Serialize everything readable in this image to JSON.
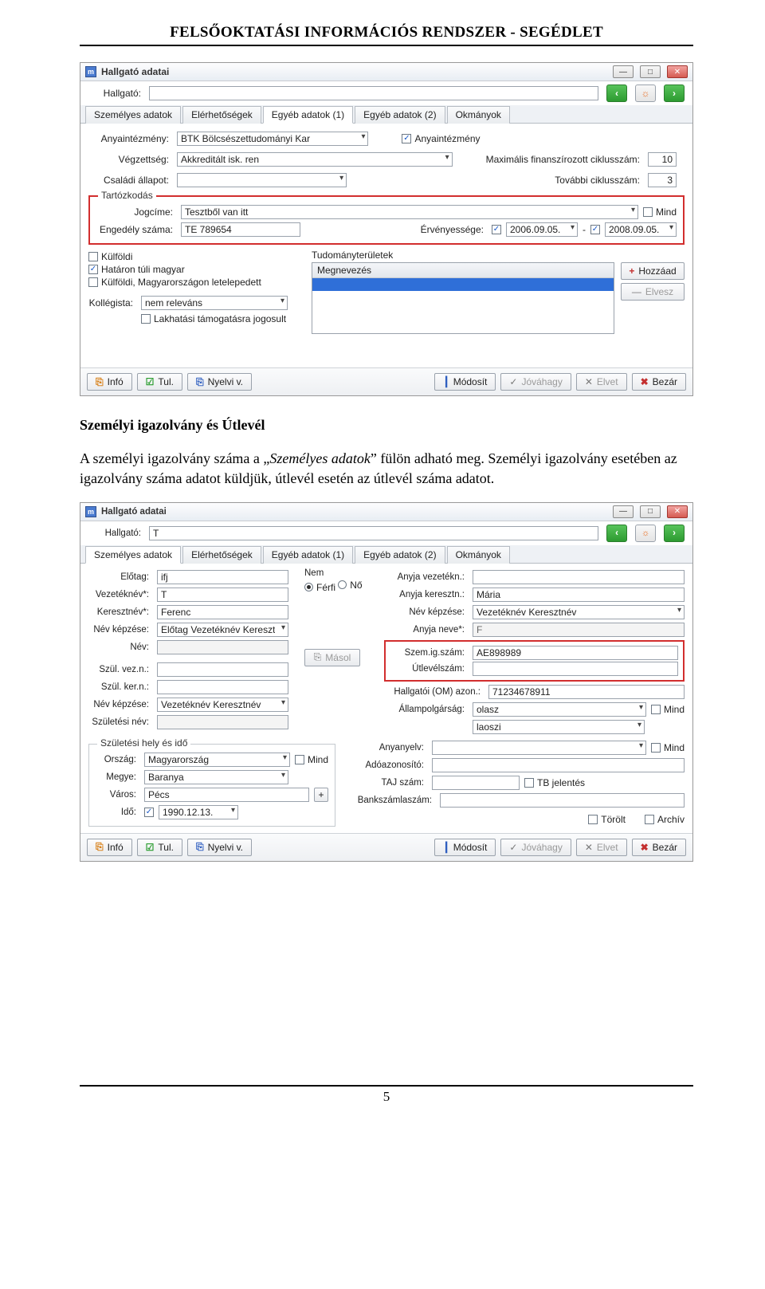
{
  "doc": {
    "header": "FELSŐOKTATÁSI INFORMÁCIÓS RENDSZER -  SEGÉDLET",
    "section_title": "Személyi igazolvány és Útlevél",
    "para1_a": "A személyi igazolvány száma a „",
    "para1_em": "Személyes adatok",
    "para1_b": "” fülön adható meg. Személyi igazolvány esetében az igazolvány száma adatot küldjük, útlevél esetén az útlevél száma adatot.",
    "page_num": "5"
  },
  "win1": {
    "title": "Hallgató adatai",
    "hallgato_label": "Hallgató:",
    "tabs": [
      "Személyes adatok",
      "Elérhetőségek",
      "Egyéb adatok (1)",
      "Egyéb adatok (2)",
      "Okmányok"
    ],
    "active_tab": 2,
    "anyaintezmeny_label": "Anyaintézmény:",
    "anyaintezmeny_value": "BTK Bölcsészettudományi Kar",
    "anyaintezmeny_chk": "Anyaintézmény",
    "vegzettseg_label": "Végzettség:",
    "vegzettseg_value": "Akkreditált isk. ren",
    "max_fin_label": "Maximális finanszírozott ciklusszám:",
    "max_fin_value": "10",
    "csaladi_label": "Családi állapot:",
    "tovabbi_label": "További ciklusszám:",
    "tovabbi_value": "3",
    "tartozkodas_title": "Tartózkodás",
    "jogcim_label": "Jogcíme:",
    "jogcim_value": "Tesztből van itt",
    "mind_label": "Mind",
    "engedely_label": "Engedély száma:",
    "engedely_value": "TE 789654",
    "ervenyesseg_label": "Érvényessége:",
    "date_from": "2006.09.05.",
    "date_to": "2008.09.05.",
    "kulfoldi": "Külföldi",
    "hataron": "Határon túli magyar",
    "kulfoldi_letelep": "Külföldi, Magyarországon letelepedett",
    "tudomany_title": "Tudományterületek",
    "megnevezes": "Megnevezés",
    "hozzaad": "Hozzáad",
    "elvesz": "Elvesz",
    "kollegista_label": "Kollégista:",
    "kollegista_value": "nem releváns",
    "lakhatasi": "Lakhatási támogatásra jogosult",
    "btns": {
      "info": "Infó",
      "tul": "Tul.",
      "nyelvi": "Nyelvi v.",
      "modosit": "Módosít",
      "jovahagy": "Jóváhagy",
      "elvet": "Elvet",
      "bezar": "Bezár"
    }
  },
  "win2": {
    "title": "Hallgató adatai",
    "hallgato_label": "Hallgató:",
    "hallgato_value": "T",
    "tabs": [
      "Személyes adatok",
      "Elérhetőségek",
      "Egyéb adatok (1)",
      "Egyéb adatok (2)",
      "Okmányok"
    ],
    "active_tab": 0,
    "elotag_label": "Előtag:",
    "elotag_value": "ifj",
    "vezeteknev_label": "Vezetéknév*:",
    "vezeteknev_value": "T",
    "keresztnev_label": "Keresztnév*:",
    "keresztnev_value": "Ferenc",
    "nevkepzese_label": "Név képzése:",
    "nevkepzese_value": "Előtag Vezetéknév Keresztnév",
    "nev_label": "Név:",
    "nem_label": "Nem",
    "ferfi": "Férfi",
    "no": "Nő",
    "anyja_vez_label": "Anyja vezetékn.:",
    "anyja_kereszt_label": "Anyja keresztn.:",
    "anyja_kereszt_value": "Mária",
    "nevkepzese2_label": "Név képzése:",
    "nevkepzese2_value": "Vezetéknév Keresztnév",
    "anyja_neve_label": "Anyja neve*:",
    "anyja_neve_value": "F",
    "szemig_label": "Szem.ig.szám:",
    "szemig_value": "AE898989",
    "utlevel_label": "Útlevélszám:",
    "szul_vezn_label": "Szül. vez.n.:",
    "szul_kern_label": "Szül. ker.n.:",
    "masol": "Másol",
    "nevkepzese3_label": "Név képzése:",
    "nevkepzese3_value": "Vezetéknév Keresztnév",
    "szuletesi_nev_label": "Születési név:",
    "szul_hely_ido_title": "Születési hely és idő",
    "orszag_label": "Ország:",
    "orszag_value": "Magyarország",
    "mind_label": "Mind",
    "megye_label": "Megye:",
    "megye_value": "Baranya",
    "varos_label": "Város:",
    "varos_value": "Pécs",
    "ido_label": "Idő:",
    "ido_value": "1990.12.13.",
    "hallg_om_label": "Hallgatói (OM) azon.:",
    "hallg_om_value": "71234678911",
    "allampolg_label": "Állampolgárság:",
    "allampolg_value": "olasz",
    "allampolg2_value": "laoszi",
    "anyanyelv_label": "Anyanyelv:",
    "adoazon_label": "Adóazonosító:",
    "taj_label": "TAJ szám:",
    "bankszamla_label": "Bankszámlaszám:",
    "tb_jelentes": "TB jelentés",
    "torolt": "Törölt",
    "archiv": "Archív",
    "btns": {
      "info": "Infó",
      "tul": "Tul.",
      "nyelvi": "Nyelvi v.",
      "modosit": "Módosít",
      "jovahagy": "Jóváhagy",
      "elvet": "Elvet",
      "bezar": "Bezár"
    }
  }
}
